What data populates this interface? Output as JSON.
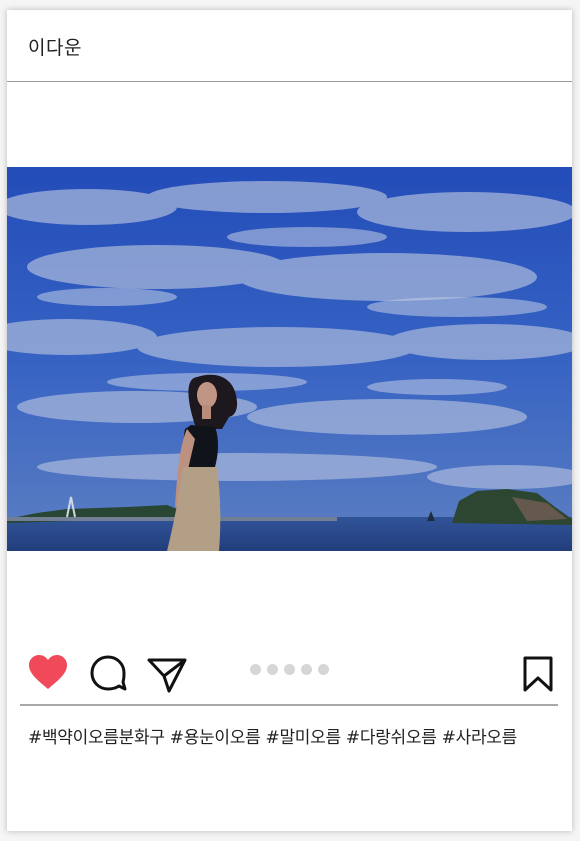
{
  "post": {
    "username": "이다운",
    "photo": {
      "description_icon": "photo-woman-by-sea-icon"
    },
    "actions": {
      "like_icon": "heart-icon",
      "comment_icon": "comment-icon",
      "share_icon": "share-icon",
      "save_icon": "bookmark-icon",
      "liked": true,
      "carousel_count": 5
    },
    "hashtags": "#백약이오름분화구 #용눈이오름 #말미오름 #다랑쉬오름 #사라오름"
  },
  "colors": {
    "heart": "#f04a5a",
    "sky": "#2f5cc7",
    "sea": "#2b4d8f",
    "dot": "#d6d6d6",
    "divider": "#a8a8a8"
  }
}
